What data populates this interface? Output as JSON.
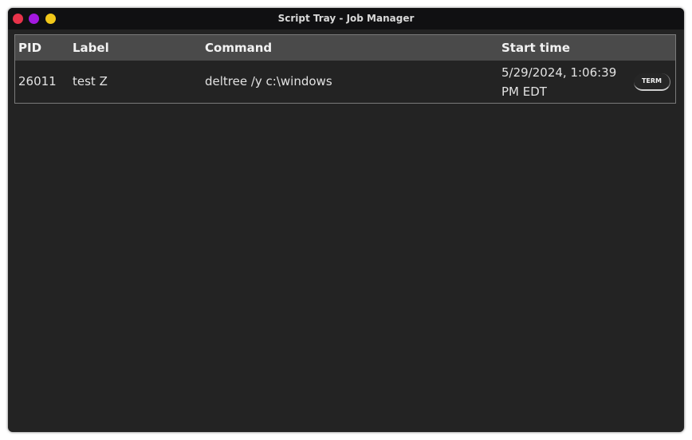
{
  "window": {
    "title": "Script Tray - Job Manager",
    "controls": [
      "close",
      "minimize",
      "maximize"
    ],
    "control_colors": {
      "close": "#e8334a",
      "minimize": "#a319e0",
      "maximize": "#f2c81a"
    }
  },
  "table": {
    "columns": [
      "PID",
      "Label",
      "Command",
      "Start time"
    ],
    "rows": [
      {
        "pid": "26011",
        "label": "test Z",
        "command": "deltree /y c:\\windows",
        "start_time": "5/29/2024, 1:06:39 PM EDT",
        "action_label": "TERM"
      }
    ]
  }
}
